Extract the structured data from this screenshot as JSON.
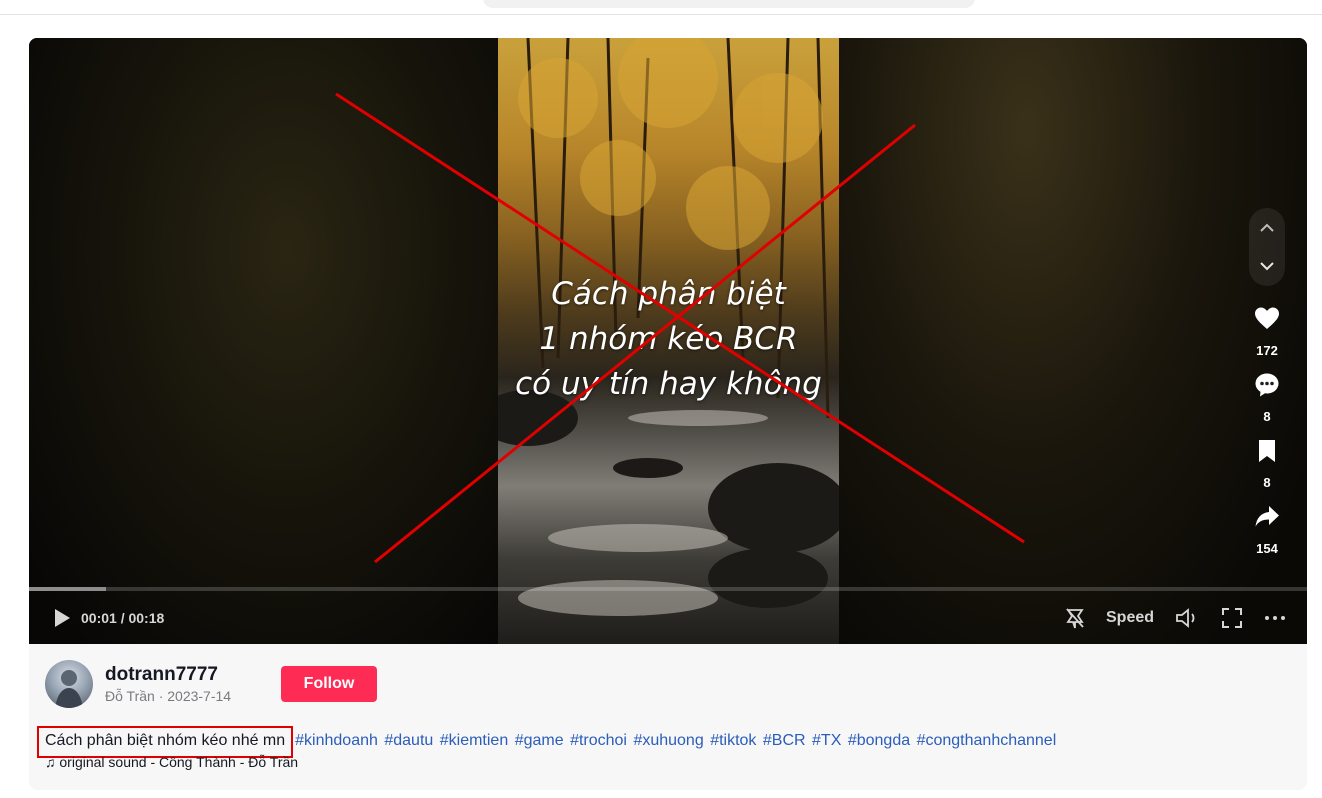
{
  "video": {
    "overlay_lines": [
      "Cách phân biệt",
      "1 nhóm kéo BCR",
      "có uy tín hay không"
    ],
    "progress_fraction": 0.06,
    "time": "00:01 / 00:18",
    "speed_label": "Speed"
  },
  "actions": {
    "likes": "172",
    "comments": "8",
    "saves": "8",
    "shares": "154"
  },
  "author": {
    "username": "dotrann7777",
    "subline": "Đỗ Trần · 2023-7-14",
    "follow_label": "Follow"
  },
  "caption": {
    "text": "Cách phân biệt nhóm kéo nhé mn",
    "hashtags": [
      "#kinhdoanh",
      "#dautu",
      "#kiemtien",
      "#game",
      "#trochoi",
      "#xuhuong",
      "#tiktok",
      "#BCR",
      "#TX",
      "#bongda",
      "#congthanhchannel"
    ]
  },
  "sound": {
    "label": "original sound - Công Thành - Đỗ Trần"
  },
  "colors": {
    "follow_bg": "#fe2c55",
    "hashtag": "#2b5db9",
    "highlight_box": "#e00000",
    "cross_lines": "#e00000"
  },
  "icons": [
    "chevron-up-icon",
    "chevron-down-icon",
    "heart-icon",
    "comment-icon",
    "bookmark-icon",
    "share-icon",
    "play-icon",
    "float-window-icon",
    "volume-icon",
    "fullscreen-icon",
    "more-icon",
    "music-note-icon"
  ]
}
